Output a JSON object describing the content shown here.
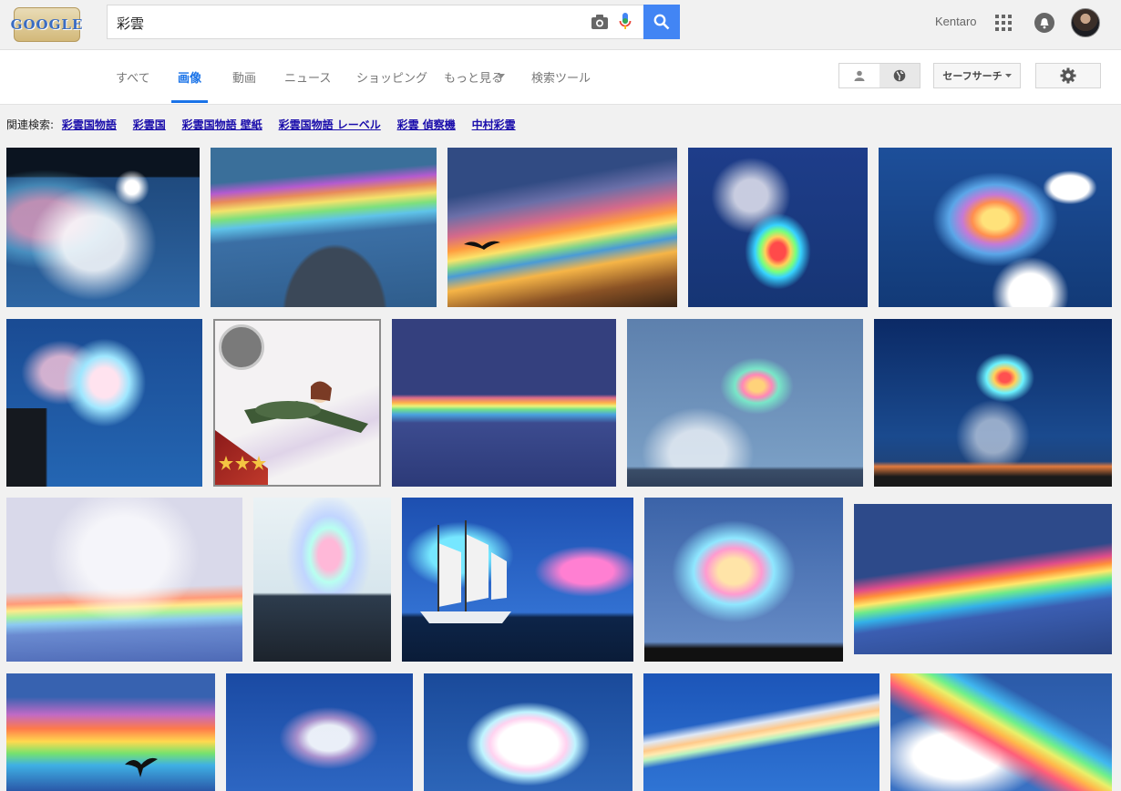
{
  "search": {
    "query": "彩雲"
  },
  "header": {
    "logo_text": "GOOGLE",
    "user_name": "Kentaro"
  },
  "tabs": [
    {
      "label": "すべて",
      "active": false
    },
    {
      "label": "画像",
      "active": true
    },
    {
      "label": "動画",
      "active": false
    },
    {
      "label": "ニュース",
      "active": false
    },
    {
      "label": "ショッピング",
      "active": false
    },
    {
      "label": "もっと見る",
      "active": false
    },
    {
      "label": "検索ツール",
      "active": false
    }
  ],
  "controls": {
    "safesearch_label": "セーフサーチ"
  },
  "related": {
    "label": "関連検索:",
    "links": [
      "彩雲国物語",
      "彩雲国",
      "彩雲国物語 壁紙",
      "彩雲国物語 レーベル",
      "彩雲 偵察機",
      "中村彩雲"
    ]
  },
  "colors": {
    "accent": "#1a73e8",
    "search_button": "#4285f4",
    "related_link": "#1a0dab"
  },
  "images": [
    {
      "name": "image-iridescent-cloud-sun",
      "subject": "rainbow cloud near sun"
    },
    {
      "name": "image-iridescent-arc",
      "subject": "rainbow arc over clouds"
    },
    {
      "name": "image-sunset-rainbow-bird",
      "subject": "sunset sky with bird"
    },
    {
      "name": "image-rainbow-plume",
      "subject": "rainbow plume"
    },
    {
      "name": "image-fire-rainbow-feathers",
      "subject": "feathery fire rainbow"
    },
    {
      "name": "image-cloud-building",
      "subject": "iridescent cloud and building"
    },
    {
      "name": "image-anime-plane-card",
      "subject": "anime aircraft card"
    },
    {
      "name": "image-rainbow-band",
      "subject": "rainbow band"
    },
    {
      "name": "image-thin-rainbow-streak",
      "subject": "thin rainbow streak"
    },
    {
      "name": "image-night-rainbow-swirl",
      "subject": "swirling rainbow at dusk"
    },
    {
      "name": "image-pastel-rainbow",
      "subject": "pastel rainbow"
    },
    {
      "name": "image-mountain-iridescent",
      "subject": "mountain and iridescent cloud"
    },
    {
      "name": "image-tall-ship",
      "subject": "tall ship with pink clouds"
    },
    {
      "name": "image-pastel-clouds-trees",
      "subject": "pastel clouds over trees"
    },
    {
      "name": "image-vivid-rainbow-band",
      "subject": "vivid rainbow band"
    },
    {
      "name": "image-rainbow-eagle",
      "subject": "rainbow with flying bird"
    },
    {
      "name": "image-wispy-rainbow",
      "subject": "wispy rainbow"
    },
    {
      "name": "image-cloud-band",
      "subject": "cloud band"
    },
    {
      "name": "image-cirrus-rainbow",
      "subject": "cirrus with rainbow"
    },
    {
      "name": "image-bright-rainbow-clouds",
      "subject": "bright rainbow clouds"
    }
  ]
}
